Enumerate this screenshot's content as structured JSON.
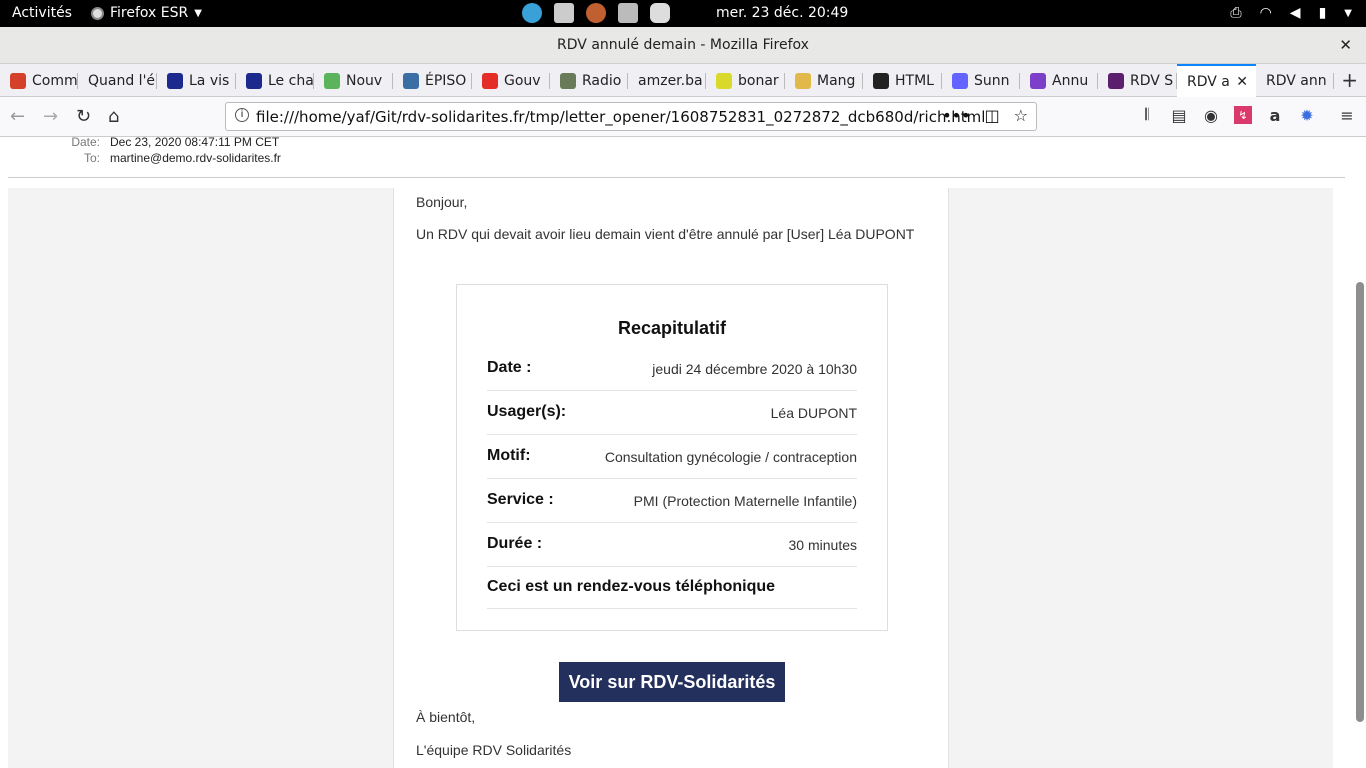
{
  "topbar": {
    "activities": "Activités",
    "app": "Firefox ESR",
    "clock": "mer. 23 déc.  20:49"
  },
  "window": {
    "title": "RDV annulé demain - Mozilla Firefox"
  },
  "tabs": [
    {
      "label": "Comm",
      "color": "#d5402b"
    },
    {
      "label": "Quand l'é",
      "color": ""
    },
    {
      "label": "La vis",
      "color": "#1b2a8c"
    },
    {
      "label": "Le cha",
      "color": "#1b2a8c"
    },
    {
      "label": "Nouv",
      "color": "#5bb35b"
    },
    {
      "label": "ÉPISO",
      "color": "#3b6ea5"
    },
    {
      "label": "Gouv",
      "color": "#e52d27"
    },
    {
      "label": "Radio",
      "color": "#6a7b5a"
    },
    {
      "label": "amzer.ba",
      "color": ""
    },
    {
      "label": "bonar",
      "color": "#d9d92c"
    },
    {
      "label": "Mang",
      "color": "#e0b94a"
    },
    {
      "label": "HTML",
      "color": "#222"
    },
    {
      "label": "Sunn",
      "color": "#6364ff"
    },
    {
      "label": "Annu",
      "color": "#7d3fc7"
    },
    {
      "label": "RDV S",
      "color": "#5b1f6e"
    },
    {
      "label": "RDV a",
      "color": ""
    },
    {
      "label": "RDV ann",
      "color": ""
    }
  ],
  "nav": {
    "url": "file:///home/yaf/Git/rdv-solidarites.fr/tmp/letter_opener/1608752831_0272872_dcb680d/rich.html"
  },
  "header": {
    "date_label": "Date:",
    "date_value": "Dec 23, 2020 08:47:11 PM CET",
    "to_label": "To:",
    "to_value": "martine@demo.rdv-solidarites.fr"
  },
  "email": {
    "greeting": "Bonjour,",
    "intro": "Un RDV qui devait avoir lieu demain vient d'être annulé par [User] Léa DUPONT",
    "card_title": "Recapitulatif",
    "rows": [
      {
        "label": "Date :",
        "value": "jeudi 24 décembre 2020 à 10h30"
      },
      {
        "label": "Usager(s):",
        "value": "Léa DUPONT"
      },
      {
        "label": "Motif:",
        "value": "Consultation gynécologie / contraception"
      },
      {
        "label": "Service :",
        "value": "PMI (Protection Maternelle Infantile)"
      },
      {
        "label": "Durée :",
        "value": "30 minutes"
      }
    ],
    "phone_note": "Ceci est un rendez-vous téléphonique",
    "cta": "Voir sur RDV-Solidarités",
    "signoff": "À bientôt,",
    "team": "L'équipe RDV Solidarités"
  }
}
